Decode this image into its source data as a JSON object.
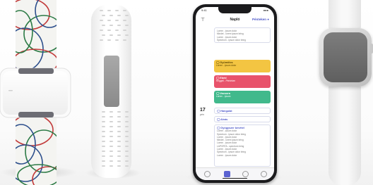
{
  "phone": {
    "status_left": "9:41",
    "status_right": "●●●",
    "appbar_title": "Napló",
    "appbar_link": "Pénteken ●",
    "filter_icon": "⊤",
    "cards_top": [
      {
        "line1": "Lorem - ipsum dolor",
        "line2": "Mindet - lorem ipsum bring",
        "line3": "Lorem - ipsum dolor",
        "line4": "Spectrum - ipsum dolor bring"
      }
    ],
    "colored_cards": [
      {
        "title": "◯ Gyümölcs",
        "sub": "Lorem - ipsum dolor",
        "color": "#f3c542"
      },
      {
        "title": "◯ Ebéd",
        "sub": "Reggeli - Pénteken",
        "color": "#e8536b"
      },
      {
        "title": "◯ Vacsora",
        "sub": "Lorem - ipsum",
        "color": "#41b98c"
      }
    ],
    "day_number": "17",
    "day_name": "pén",
    "chip_cards": [
      {
        "title": "◯ Hangulat"
      },
      {
        "title": "◯ Alvás"
      }
    ],
    "bottom_card": {
      "title": "◯ Gyógyszer bevétel",
      "lines": [
        "Lorem - ipsum dolor",
        "Spectrum - ipsum dolor bring",
        "Lorem - ipsum dolor",
        "Mindet - lorem ipsum bring",
        "Lorem - ipsum dolor",
        "LAPORTA - spectrum bring",
        "Lorem - ipsum dolor",
        "Spectrum - ipsum dolor bring",
        "Lorem - ipsum dolor"
      ]
    },
    "tabs": [
      "home",
      "journal",
      "stats",
      "profile"
    ]
  },
  "band_logo": "",
  "colors": {
    "accent": "#5b63d1",
    "yellow": "#f3c542",
    "red": "#e8536b",
    "green": "#41b98c"
  }
}
